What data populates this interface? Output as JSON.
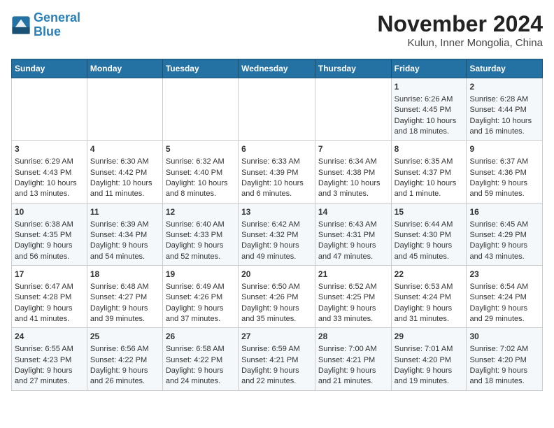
{
  "logo": {
    "line1": "General",
    "line2": "Blue"
  },
  "title": "November 2024",
  "subtitle": "Kulun, Inner Mongolia, China",
  "days_of_week": [
    "Sunday",
    "Monday",
    "Tuesday",
    "Wednesday",
    "Thursday",
    "Friday",
    "Saturday"
  ],
  "weeks": [
    [
      {
        "day": "",
        "data": ""
      },
      {
        "day": "",
        "data": ""
      },
      {
        "day": "",
        "data": ""
      },
      {
        "day": "",
        "data": ""
      },
      {
        "day": "",
        "data": ""
      },
      {
        "day": "1",
        "data": "Sunrise: 6:26 AM\nSunset: 4:45 PM\nDaylight: 10 hours and 18 minutes."
      },
      {
        "day": "2",
        "data": "Sunrise: 6:28 AM\nSunset: 4:44 PM\nDaylight: 10 hours and 16 minutes."
      }
    ],
    [
      {
        "day": "3",
        "data": "Sunrise: 6:29 AM\nSunset: 4:43 PM\nDaylight: 10 hours and 13 minutes."
      },
      {
        "day": "4",
        "data": "Sunrise: 6:30 AM\nSunset: 4:42 PM\nDaylight: 10 hours and 11 minutes."
      },
      {
        "day": "5",
        "data": "Sunrise: 6:32 AM\nSunset: 4:40 PM\nDaylight: 10 hours and 8 minutes."
      },
      {
        "day": "6",
        "data": "Sunrise: 6:33 AM\nSunset: 4:39 PM\nDaylight: 10 hours and 6 minutes."
      },
      {
        "day": "7",
        "data": "Sunrise: 6:34 AM\nSunset: 4:38 PM\nDaylight: 10 hours and 3 minutes."
      },
      {
        "day": "8",
        "data": "Sunrise: 6:35 AM\nSunset: 4:37 PM\nDaylight: 10 hours and 1 minute."
      },
      {
        "day": "9",
        "data": "Sunrise: 6:37 AM\nSunset: 4:36 PM\nDaylight: 9 hours and 59 minutes."
      }
    ],
    [
      {
        "day": "10",
        "data": "Sunrise: 6:38 AM\nSunset: 4:35 PM\nDaylight: 9 hours and 56 minutes."
      },
      {
        "day": "11",
        "data": "Sunrise: 6:39 AM\nSunset: 4:34 PM\nDaylight: 9 hours and 54 minutes."
      },
      {
        "day": "12",
        "data": "Sunrise: 6:40 AM\nSunset: 4:33 PM\nDaylight: 9 hours and 52 minutes."
      },
      {
        "day": "13",
        "data": "Sunrise: 6:42 AM\nSunset: 4:32 PM\nDaylight: 9 hours and 49 minutes."
      },
      {
        "day": "14",
        "data": "Sunrise: 6:43 AM\nSunset: 4:31 PM\nDaylight: 9 hours and 47 minutes."
      },
      {
        "day": "15",
        "data": "Sunrise: 6:44 AM\nSunset: 4:30 PM\nDaylight: 9 hours and 45 minutes."
      },
      {
        "day": "16",
        "data": "Sunrise: 6:45 AM\nSunset: 4:29 PM\nDaylight: 9 hours and 43 minutes."
      }
    ],
    [
      {
        "day": "17",
        "data": "Sunrise: 6:47 AM\nSunset: 4:28 PM\nDaylight: 9 hours and 41 minutes."
      },
      {
        "day": "18",
        "data": "Sunrise: 6:48 AM\nSunset: 4:27 PM\nDaylight: 9 hours and 39 minutes."
      },
      {
        "day": "19",
        "data": "Sunrise: 6:49 AM\nSunset: 4:26 PM\nDaylight: 9 hours and 37 minutes."
      },
      {
        "day": "20",
        "data": "Sunrise: 6:50 AM\nSunset: 4:26 PM\nDaylight: 9 hours and 35 minutes."
      },
      {
        "day": "21",
        "data": "Sunrise: 6:52 AM\nSunset: 4:25 PM\nDaylight: 9 hours and 33 minutes."
      },
      {
        "day": "22",
        "data": "Sunrise: 6:53 AM\nSunset: 4:24 PM\nDaylight: 9 hours and 31 minutes."
      },
      {
        "day": "23",
        "data": "Sunrise: 6:54 AM\nSunset: 4:24 PM\nDaylight: 9 hours and 29 minutes."
      }
    ],
    [
      {
        "day": "24",
        "data": "Sunrise: 6:55 AM\nSunset: 4:23 PM\nDaylight: 9 hours and 27 minutes."
      },
      {
        "day": "25",
        "data": "Sunrise: 6:56 AM\nSunset: 4:22 PM\nDaylight: 9 hours and 26 minutes."
      },
      {
        "day": "26",
        "data": "Sunrise: 6:58 AM\nSunset: 4:22 PM\nDaylight: 9 hours and 24 minutes."
      },
      {
        "day": "27",
        "data": "Sunrise: 6:59 AM\nSunset: 4:21 PM\nDaylight: 9 hours and 22 minutes."
      },
      {
        "day": "28",
        "data": "Sunrise: 7:00 AM\nSunset: 4:21 PM\nDaylight: 9 hours and 21 minutes."
      },
      {
        "day": "29",
        "data": "Sunrise: 7:01 AM\nSunset: 4:20 PM\nDaylight: 9 hours and 19 minutes."
      },
      {
        "day": "30",
        "data": "Sunrise: 7:02 AM\nSunset: 4:20 PM\nDaylight: 9 hours and 18 minutes."
      }
    ]
  ]
}
